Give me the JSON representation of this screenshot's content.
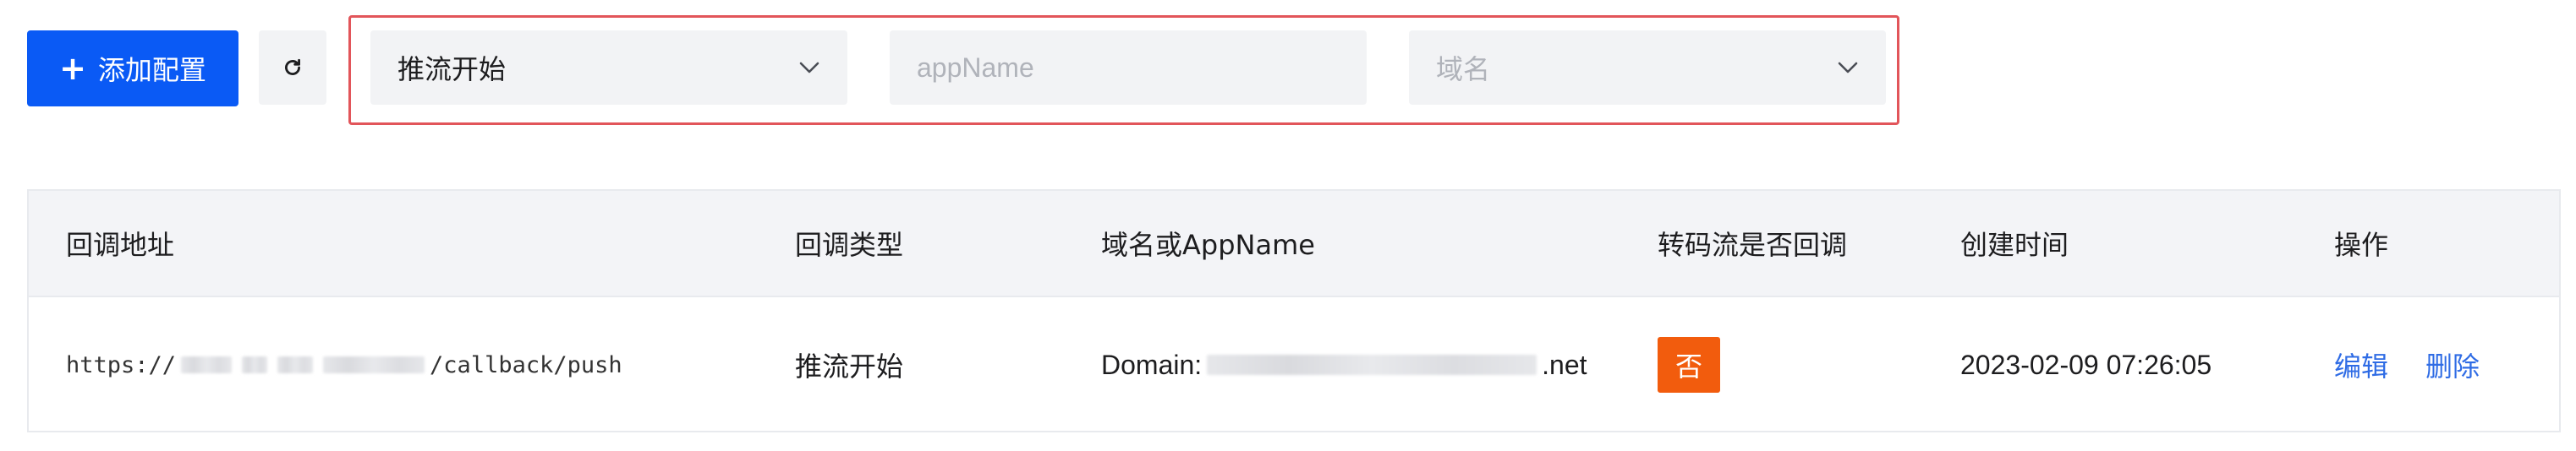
{
  "toolbar": {
    "add_label": "添加配置",
    "add_icon": "plus-icon",
    "refresh_icon": "refresh-icon",
    "accent_color": "#0a5af5",
    "filters": {
      "callback_type_value": "推流开始",
      "app_name_placeholder": "appName",
      "domain_placeholder": "域名"
    }
  },
  "table": {
    "columns": [
      "回调地址",
      "回调类型",
      "域名或AppName",
      "转码流是否回调",
      "创建时间",
      "操作"
    ],
    "rows": [
      {
        "url_prefix": "https://",
        "url_suffix": "/callback/push",
        "type": "推流开始",
        "domain_prefix": "Domain:",
        "domain_suffix": ".net",
        "transcode_callback": "否",
        "transcode_badge_color": "#f25c0d",
        "created_at": "2023-02-09 07:26:05",
        "actions": {
          "edit": "编辑",
          "delete": "删除"
        }
      }
    ]
  }
}
